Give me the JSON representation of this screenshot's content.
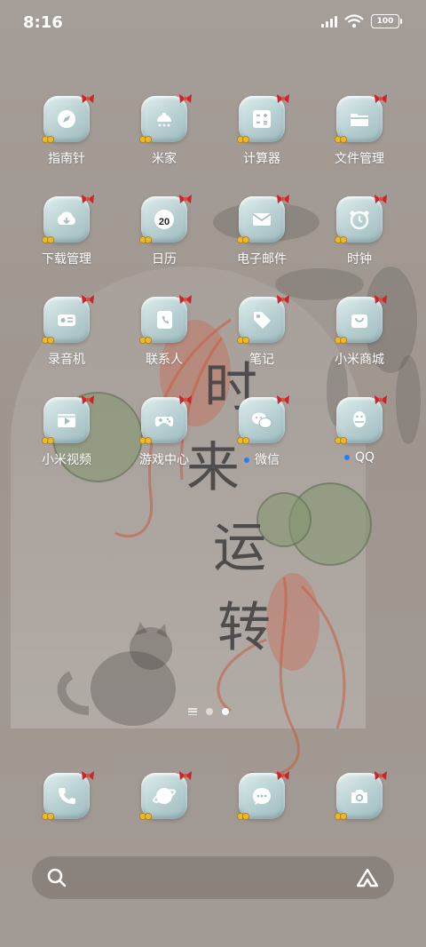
{
  "status_bar": {
    "time": "8:16",
    "battery": "100"
  },
  "wallpaper": {
    "chars": [
      "时",
      "来",
      "运",
      "转"
    ]
  },
  "apps": [
    {
      "label": "指南针",
      "icon": "compass-icon",
      "dot": false
    },
    {
      "label": "米家",
      "icon": "smart-home-icon",
      "dot": false
    },
    {
      "label": "计算器",
      "icon": "calculator-icon",
      "dot": false
    },
    {
      "label": "文件管理",
      "icon": "folder-icon",
      "dot": false
    },
    {
      "label": "下载管理",
      "icon": "download-icon",
      "dot": false
    },
    {
      "label": "日历",
      "icon": "calendar-icon",
      "dot": false,
      "badge": "20"
    },
    {
      "label": "电子邮件",
      "icon": "mail-icon",
      "dot": false
    },
    {
      "label": "时钟",
      "icon": "alarm-clock-icon",
      "dot": false
    },
    {
      "label": "录音机",
      "icon": "recorder-icon",
      "dot": false
    },
    {
      "label": "联系人",
      "icon": "contacts-icon",
      "dot": false
    },
    {
      "label": "笔记",
      "icon": "tag-icon",
      "dot": false
    },
    {
      "label": "小米商城",
      "icon": "shopping-bag-icon",
      "dot": false
    },
    {
      "label": "小米视频",
      "icon": "video-icon",
      "dot": false
    },
    {
      "label": "游戏中心",
      "icon": "gamepad-icon",
      "dot": false
    },
    {
      "label": "微信",
      "icon": "wechat-icon",
      "dot": true
    },
    {
      "label": "QQ",
      "icon": "qq-penguin-icon",
      "dot": true
    }
  ],
  "dock": [
    {
      "icon": "phone-icon"
    },
    {
      "icon": "browser-icon"
    },
    {
      "icon": "messages-icon"
    },
    {
      "icon": "camera-icon"
    }
  ],
  "pages": {
    "current": 2,
    "total": 2
  },
  "colors": {
    "accent_dot": "#2a7ff0",
    "icon_glass": "#b7cfd1",
    "bow": "#c8252c"
  }
}
